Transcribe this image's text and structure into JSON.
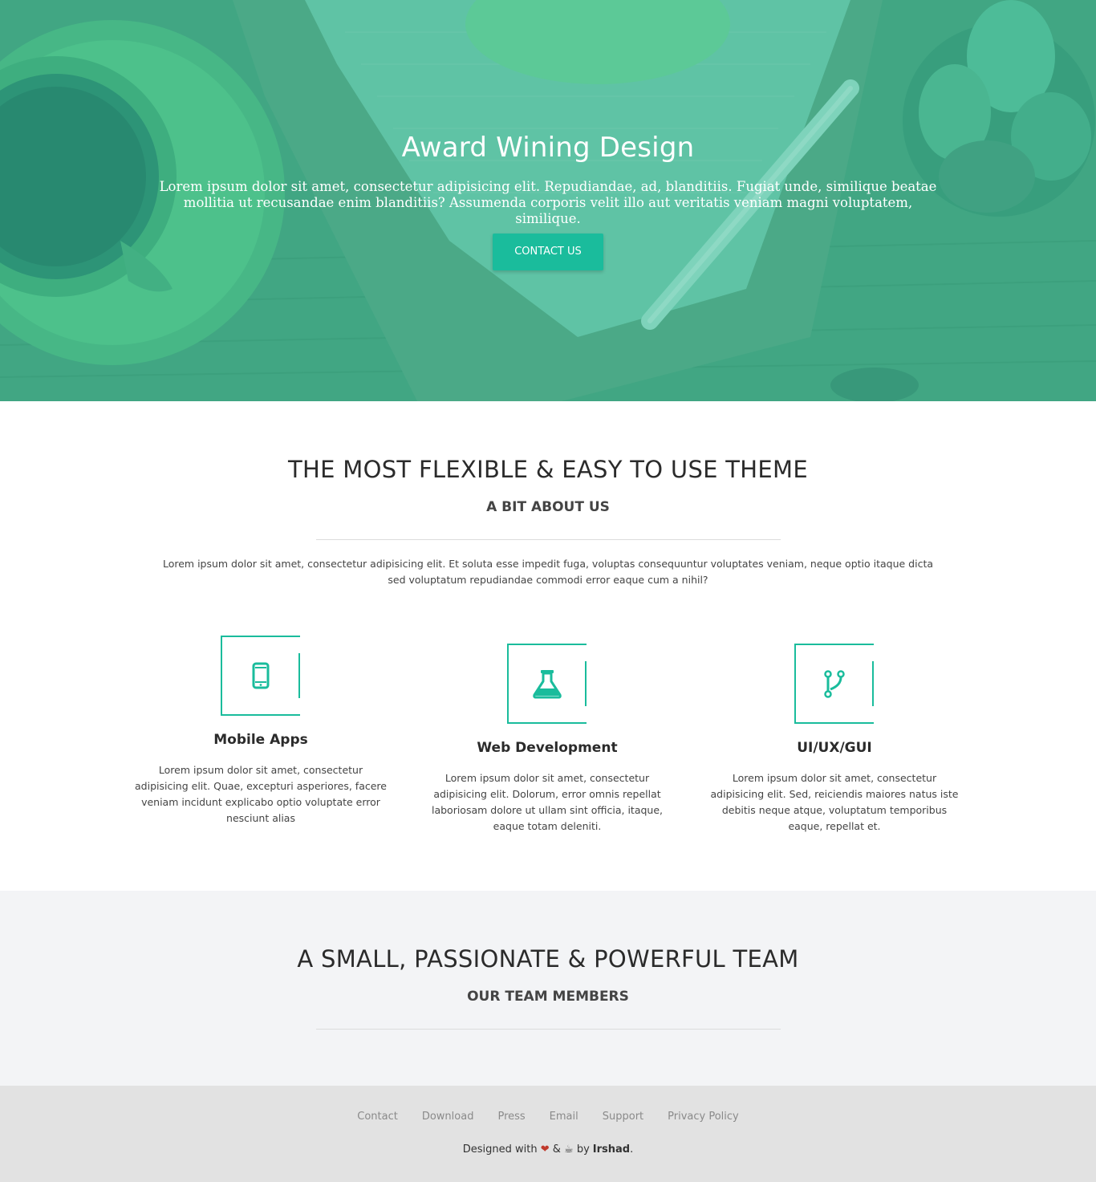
{
  "hero": {
    "title": "Award Wining Design",
    "text": "Lorem ipsum dolor sit amet, consectetur adipisicing elit. Repudiandae, ad, blanditiis. Fugiat unde, similique beatae mollitia ut recusandae enim blanditiis? Assumenda corporis velit illo aut veritatis veniam magni voluptatem, similique.",
    "button": "CONTACT US"
  },
  "about": {
    "title": "THE MOST FLEXIBLE & EASY TO USE THEME",
    "subtitle": "A BIT ABOUT US",
    "text": "Lorem ipsum dolor sit amet, consectetur adipisicing elit. Et soluta esse impedit fuga, voluptas consequuntur voluptates veniam, neque optio itaque dicta sed voluptatum repudiandae commodi error eaque cum a nihil?",
    "features": [
      {
        "icon": "mobile-phone-icon",
        "title": "Mobile Apps",
        "text": "Lorem ipsum dolor sit amet, consectetur adipisicing elit. Quae, excepturi asperiores, facere veniam incidunt explicabo optio voluptate error nesciunt alias"
      },
      {
        "icon": "flask-icon",
        "title": "Web Development",
        "text": "Lorem ipsum dolor sit amet, consectetur adipisicing elit. Dolorum, error omnis repellat laboriosam dolore ut ullam sint officia, itaque, eaque totam deleniti."
      },
      {
        "icon": "code-fork-icon",
        "title": "UI/UX/GUI",
        "text": "Lorem ipsum dolor sit amet, consectetur adipisicing elit. Sed, reiciendis maiores natus iste debitis neque atque, voluptatum temporibus eaque, repellat et."
      }
    ]
  },
  "team": {
    "title": "A SMALL, PASSIONATE & POWERFUL TEAM",
    "subtitle": "OUR TEAM MEMBERS"
  },
  "footer": {
    "links": [
      "Contact",
      "Download",
      "Press",
      "Email",
      "Support",
      "Privacy Policy"
    ],
    "credit_prefix": "Designed with",
    "heart": "❤",
    "ampersand": "&",
    "cup": "☕",
    "credit_by": "by",
    "author": "Irshad",
    "period": "."
  },
  "colors": {
    "accent": "#1abc9c",
    "hero_overlay": "#4fb595",
    "team_bg": "#f3f4f6",
    "footer_bg": "#e2e2e2"
  }
}
